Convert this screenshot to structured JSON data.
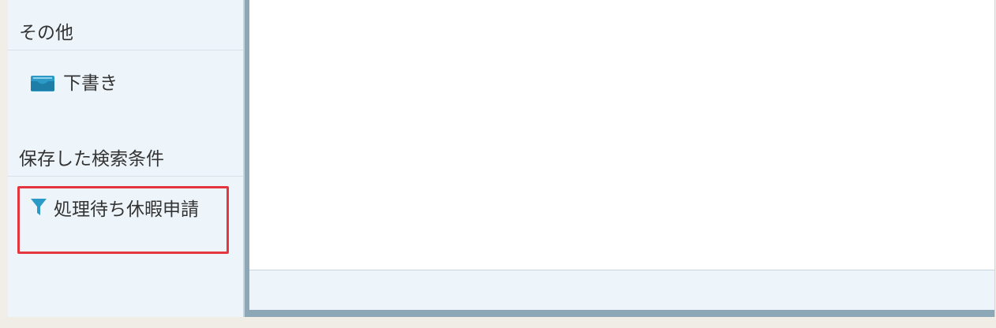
{
  "sidebar": {
    "sections": [
      {
        "title": "その他",
        "items": [
          {
            "label": "下書き",
            "icon": "inbox-tray-icon"
          }
        ]
      },
      {
        "title": "保存した検索条件",
        "items": [
          {
            "label": "処理待ち休暇申請",
            "icon": "filter-icon",
            "highlighted": true
          }
        ]
      }
    ]
  },
  "colors": {
    "accent": "#2c9ac7",
    "highlight_border": "#e3363f",
    "sidebar_bg": "#eef5fa",
    "frame": "#8ca7b6"
  }
}
